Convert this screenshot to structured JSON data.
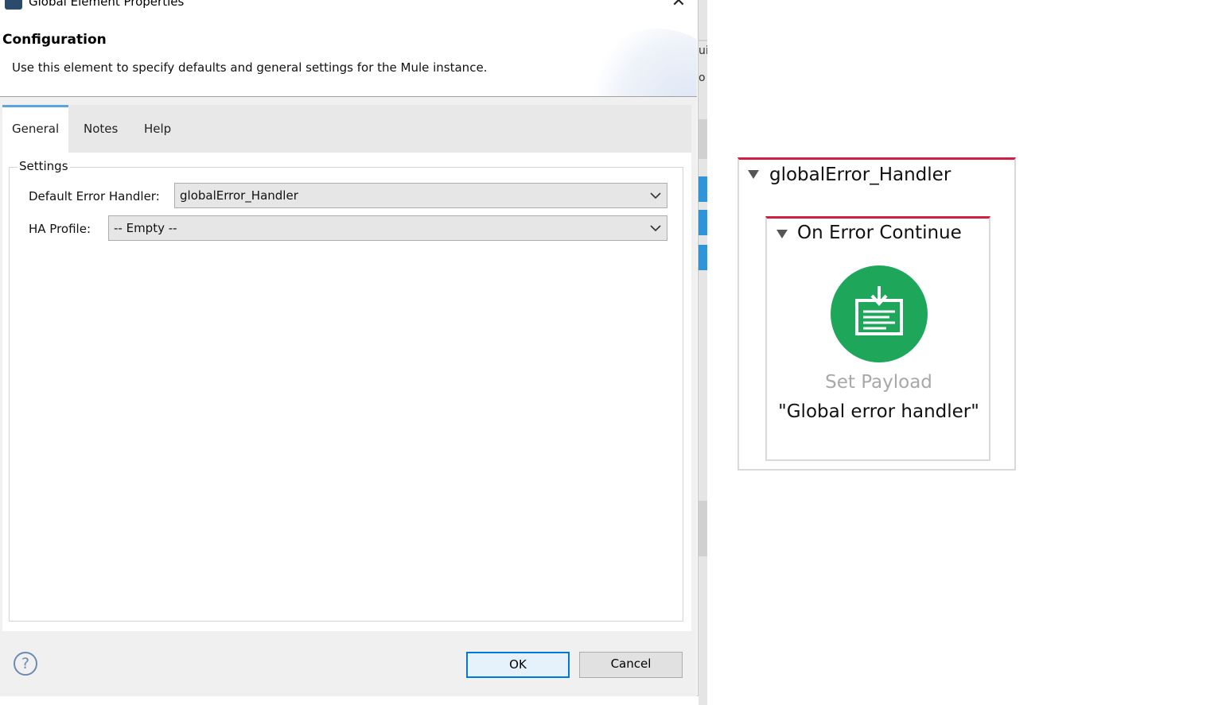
{
  "window": {
    "title": "Global Element Properties",
    "close_symbol": "✕"
  },
  "banner": {
    "title": "Configuration",
    "description": "Use this element to specify defaults and general settings for the Mule instance."
  },
  "tabs": [
    {
      "label": "General",
      "active": true
    },
    {
      "label": "Notes",
      "active": false
    },
    {
      "label": "Help",
      "active": false
    }
  ],
  "settings": {
    "legend": "Settings",
    "default_error_handler": {
      "label": "Default Error Handler:",
      "value": "globalError_Handler"
    },
    "ha_profile": {
      "label": "HA Profile:",
      "value": "-- Empty --"
    }
  },
  "footer": {
    "help_symbol": "?",
    "ok_label": "OK",
    "cancel_label": "Cancel"
  },
  "background": {
    "fragment_1": "ui",
    "fragment_2": "o"
  },
  "flow": {
    "handler_name": "globalError_Handler",
    "scope_name": "On Error Continue",
    "component_type": "Set Payload",
    "component_name": "\"Global error handler\"",
    "accent_color": "#d11f44",
    "component_color": "#1ea75a",
    "component_icon": "set-payload-icon"
  }
}
